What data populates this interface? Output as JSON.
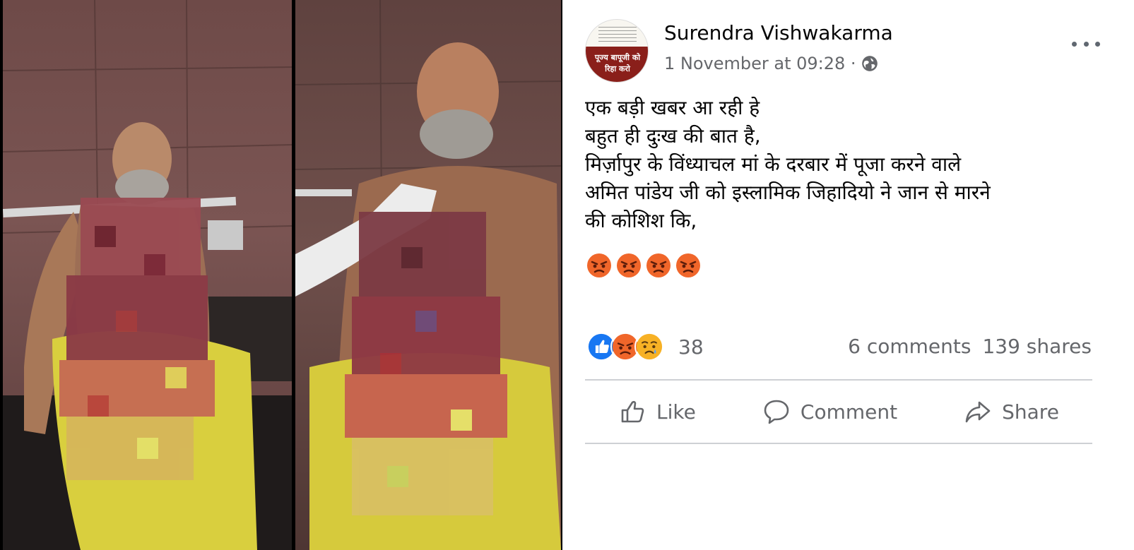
{
  "post": {
    "author": "Surendra Vishwakarma",
    "timestamp": "1 November at 09:28 ·",
    "avatar_text": "पूज्य बापूजी को रिहा करो",
    "lines": [
      "एक बड़ी खबर आ रही हे",
      "बहुत ही दुःख की बात है,",
      "मिर्ज़ापुर के विंध्याचल मां के दरबार में पूजा करने वाले",
      "अमित पांडेय जी को इस्लामिक जिहादियो ने जान से मारने",
      "की कोशिश कि,"
    ],
    "emoji": [
      "angry-face-emoji",
      "angry-face-emoji",
      "angry-face-emoji",
      "angry-face-emoji"
    ],
    "reaction_icons": [
      "like-reaction-icon",
      "angry-reaction-icon",
      "sad-reaction-icon"
    ],
    "reaction_count": "38",
    "comments": "6 comments",
    "shares": "139 shares",
    "actions": {
      "like": "Like",
      "comment": "Comment",
      "share": "Share"
    }
  },
  "colors": {
    "reaction_blue": "#1877f2",
    "angry_orange": "#f0662a",
    "sad_yellow": "#f7b125",
    "muted_text": "#65676b",
    "divider": "#ced0d4"
  },
  "images": [
    "blurred-photo-left",
    "blurred-photo-right"
  ]
}
